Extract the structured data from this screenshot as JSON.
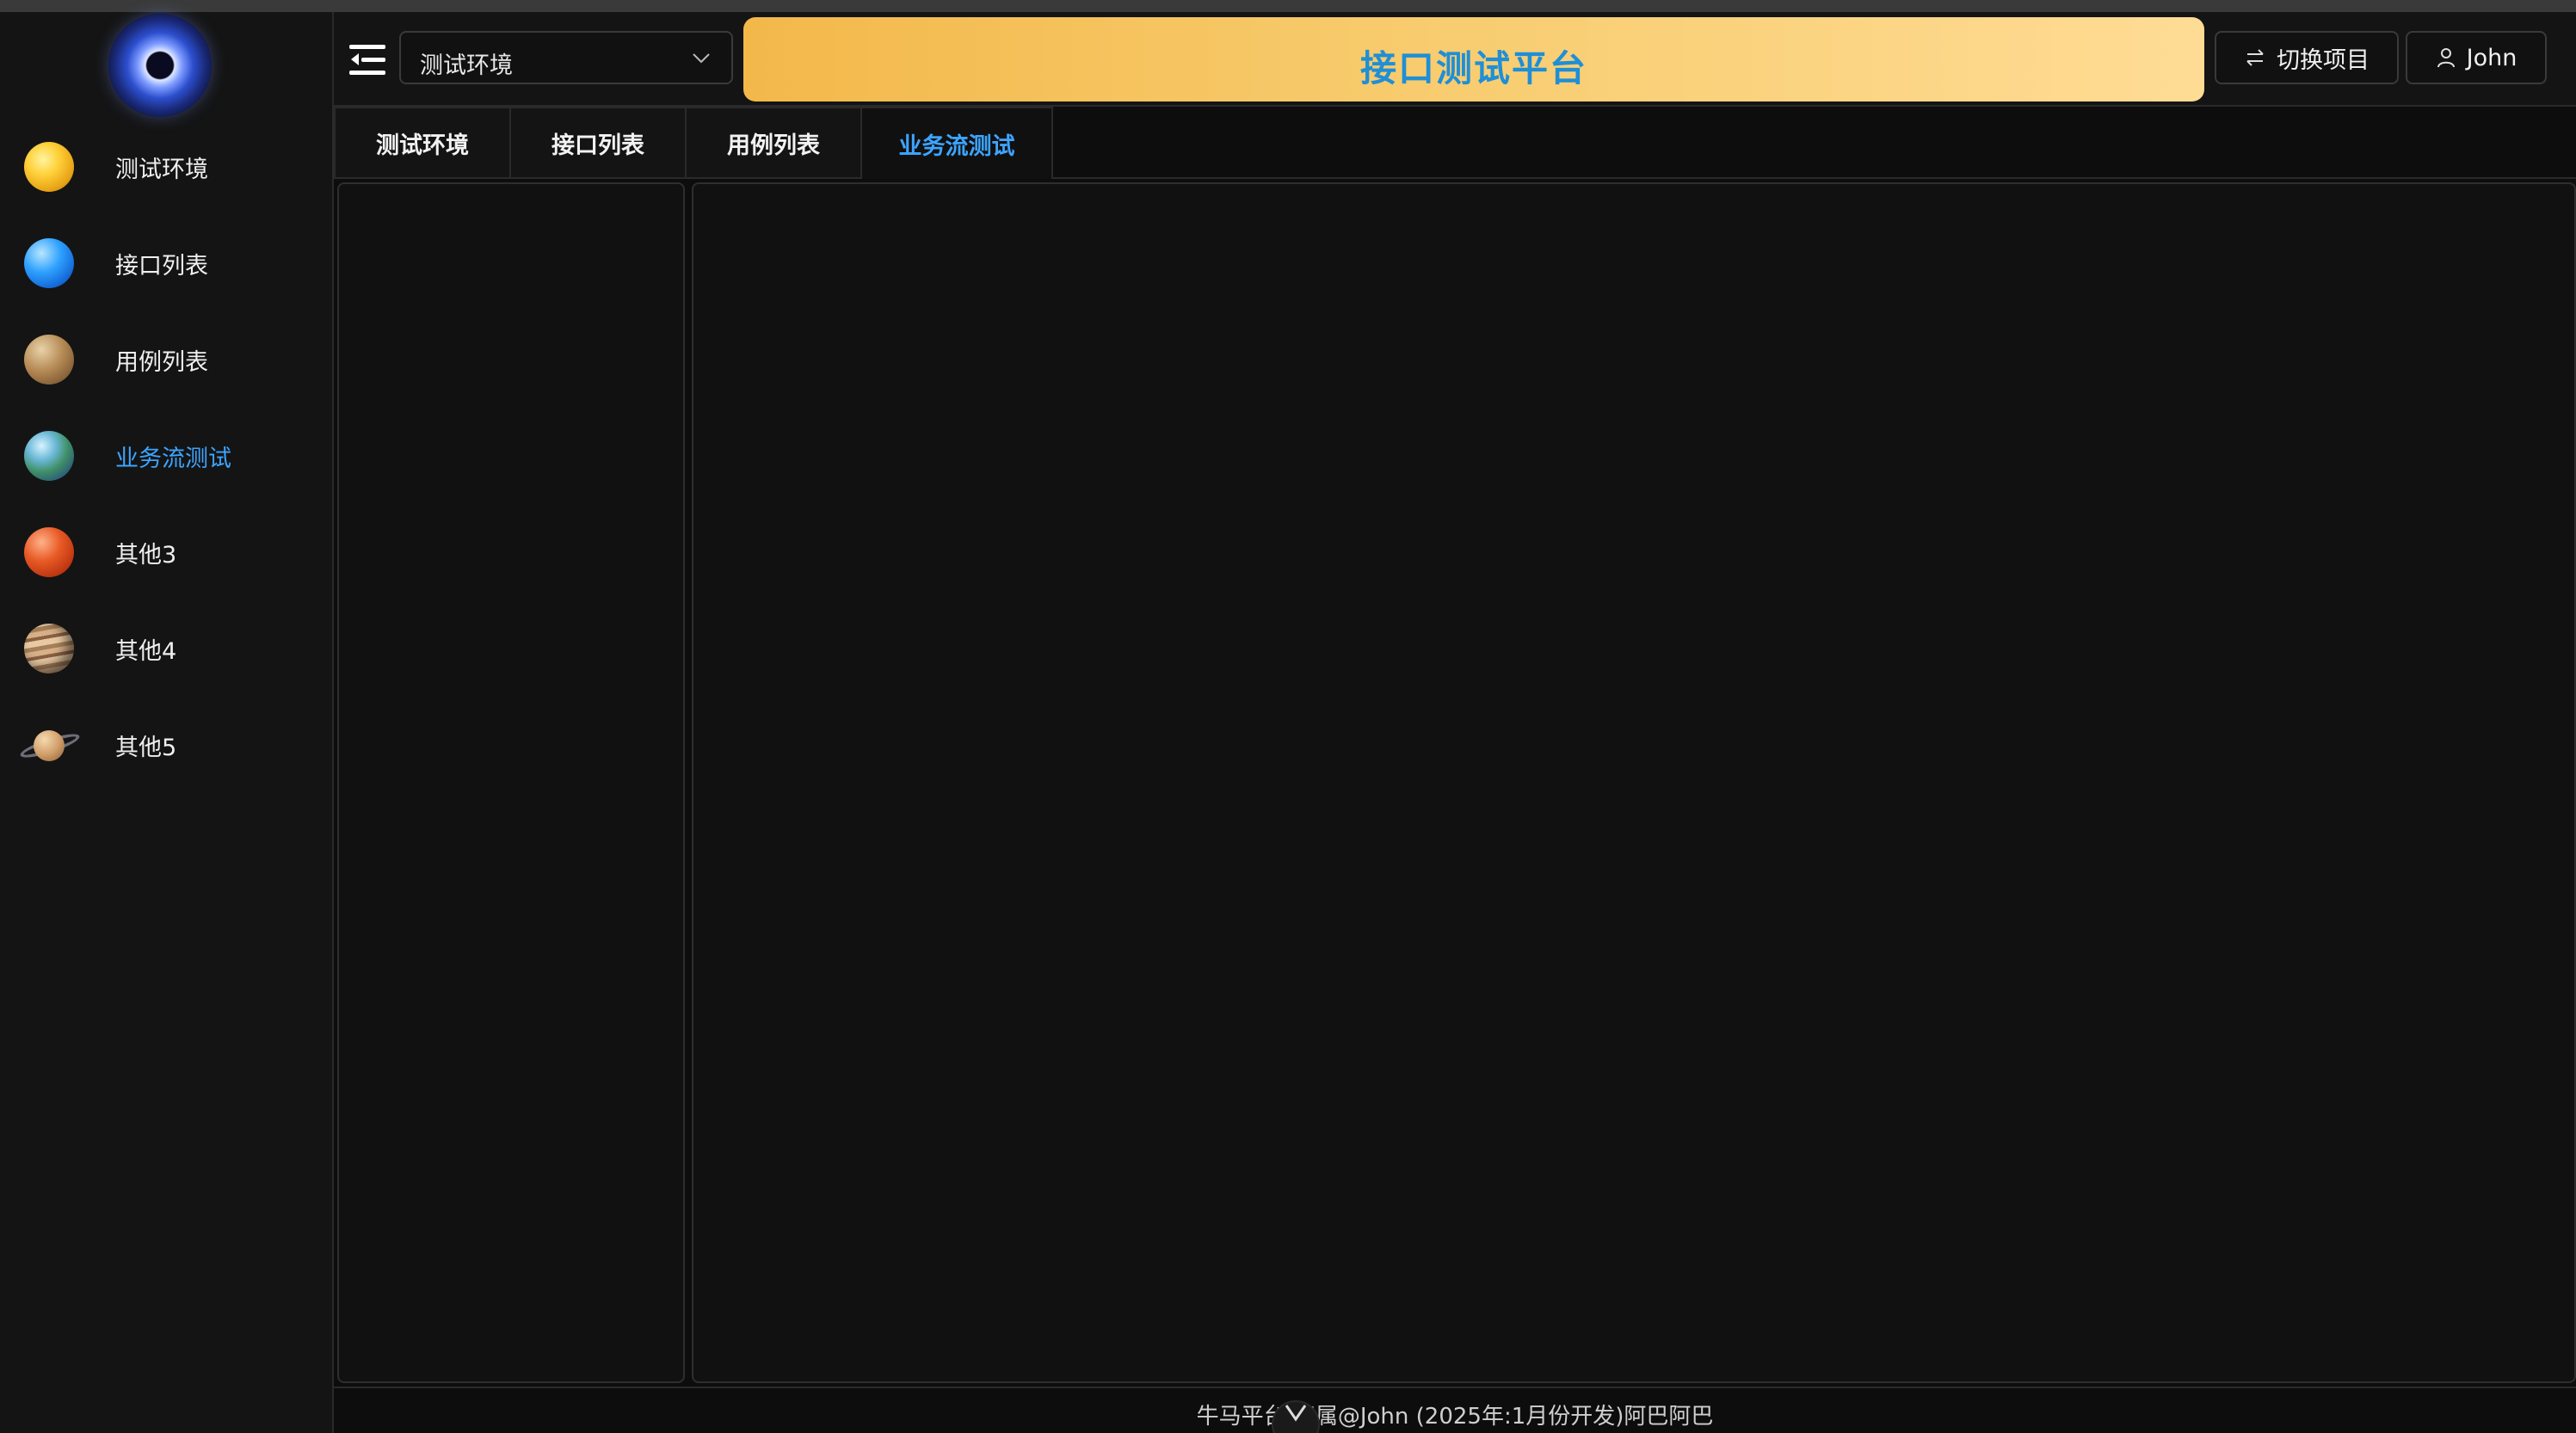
{
  "sidebar": {
    "items": [
      {
        "label": "测试环境",
        "icon": "sun-planet-icon"
      },
      {
        "label": "接口列表",
        "icon": "blue-planet-icon"
      },
      {
        "label": "用例列表",
        "icon": "venus-planet-icon"
      },
      {
        "label": "业务流测试",
        "icon": "earth-planet-icon",
        "active": true
      },
      {
        "label": "其他3",
        "icon": "mars-planet-icon"
      },
      {
        "label": "其他4",
        "icon": "jupiter-planet-icon"
      },
      {
        "label": "其他5",
        "icon": "saturn-planet-icon"
      }
    ]
  },
  "header": {
    "env_select_value": "测试环境",
    "title": "接口测试平台",
    "switch_label": "切换项目",
    "user_label": "John"
  },
  "tabs": [
    {
      "label": "测试环境"
    },
    {
      "label": "接口列表"
    },
    {
      "label": "用例列表"
    },
    {
      "label": "业务流测试",
      "active": true
    }
  ],
  "footer": {
    "text": "牛马平台     归属@John (2025年:1月份开发)阿巴阿巴"
  },
  "colors": {
    "accent": "#3da4ff",
    "title_bg_start": "#f3b84a",
    "title_bg_end": "#ffdc95",
    "title_text": "#1f8fd6",
    "background": "#0d0d0d"
  }
}
